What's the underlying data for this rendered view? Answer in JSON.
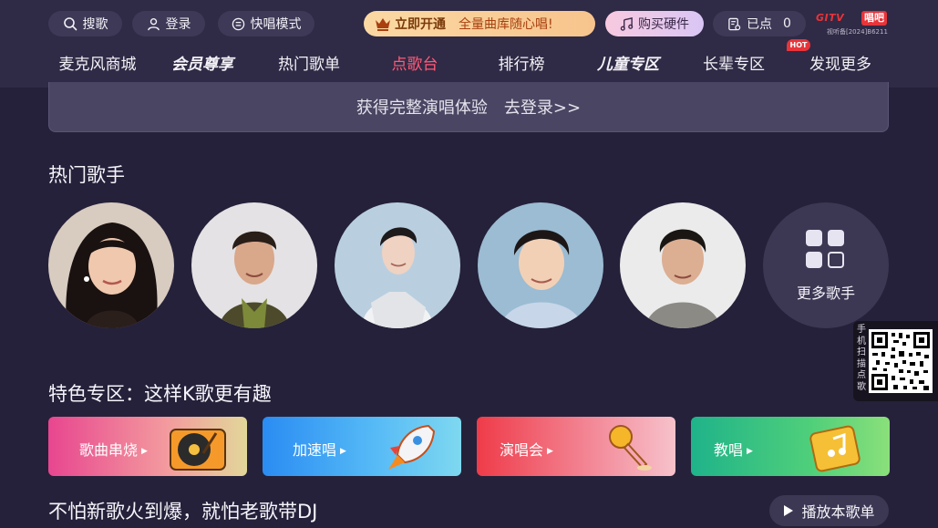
{
  "topbar": {
    "search_label": "搜歌",
    "login_label": "登录",
    "quick_mode_label": "快唱模式",
    "vip_open_label": "立即开通",
    "vip_desc": "全量曲库随心唱!",
    "buy_hardware_label": "购买硬件",
    "queued_label": "已点",
    "queued_count": "0",
    "brand_gitv": "GITV",
    "brand_changba": "唱吧",
    "license_text": "视听备[2024]B6211"
  },
  "nav": {
    "items": [
      {
        "label": "麦克风商城"
      },
      {
        "label": "会员尊享"
      },
      {
        "label": "热门歌单"
      },
      {
        "label": "点歌台"
      },
      {
        "label": "排行榜"
      },
      {
        "label": "儿童专区"
      },
      {
        "label": "长辈专区"
      },
      {
        "label": "发现更多"
      }
    ],
    "hot_badge": "HOT",
    "active": "点歌台"
  },
  "login_banner": {
    "text": "获得完整演唱体验",
    "link": "去登录>>"
  },
  "hot_singers": {
    "title": "热门歌手",
    "more_label": "更多歌手"
  },
  "qr": {
    "caption": "手机扫描点歌"
  },
  "features": {
    "title": "特色专区：这样K歌更有趣",
    "cards": [
      {
        "label": "歌曲串烧",
        "icon": "record-player-icon"
      },
      {
        "label": "加速唱",
        "icon": "rocket-icon"
      },
      {
        "label": "演唱会",
        "icon": "microphone-icon"
      },
      {
        "label": "教唱",
        "icon": "music-book-icon"
      }
    ]
  },
  "playlist": {
    "title": "不怕新歌火到爆，就怕老歌带DJ",
    "play_label": "播放本歌单"
  },
  "colors": {
    "background": "#25213a",
    "active_nav": "#ff5a79",
    "brand_red": "#e8343a"
  }
}
